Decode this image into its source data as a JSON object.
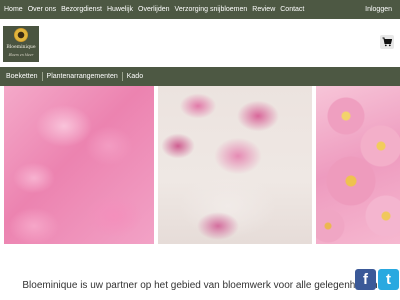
{
  "topnav": {
    "items": [
      "Home",
      "Over ons",
      "Bezorgdienst",
      "Huwelijk",
      "Overlijden",
      "Verzorging snijbloemen",
      "Review",
      "Contact"
    ],
    "login": "Inloggen"
  },
  "logo": {
    "name": "Bloeminique",
    "tagline": "Bloem en Meer"
  },
  "catnav": {
    "items": [
      "Boeketten",
      "Plantenarrangementen",
      "Kado"
    ]
  },
  "tagline": "Bloeminique is uw partner op het gebied van bloemwerk voor alle gelegenheden",
  "social": {
    "facebook_label": "f",
    "twitter_label": "t"
  },
  "colors": {
    "bar": "#4d5843",
    "facebook": "#3b5998",
    "twitter": "#29a9e0"
  },
  "icons": [
    "cart-icon",
    "facebook-icon",
    "twitter-icon"
  ]
}
